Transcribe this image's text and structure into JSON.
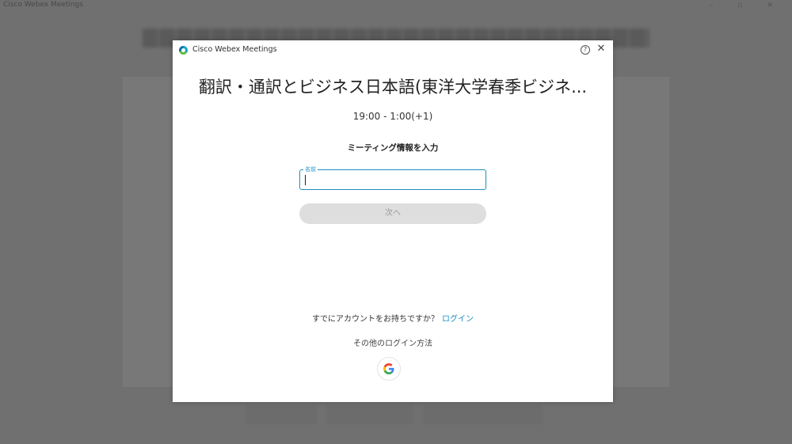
{
  "background_window": {
    "title": "Cisco Webex Meetings"
  },
  "dialog": {
    "app_title": "Cisco Webex Meetings",
    "meeting_title": "翻訳・通訳とビジネス日本語(東洋大学春季ビジネ...",
    "meeting_time": "19:00 - 1:00(+1)",
    "info_heading": "ミーティング情報を入力",
    "name_field": {
      "label": "名前",
      "value": ""
    },
    "next_button_label": "次へ",
    "account_prompt": "すでにアカウントをお持ちですか？",
    "login_link": "ログイン",
    "other_login_label": "その他のログイン方法",
    "icons": {
      "app_logo": "webex-logo",
      "help": "help-icon",
      "close": "close-icon",
      "google": "google-icon"
    },
    "colors": {
      "accent": "#1a8fc0",
      "disabled_button": "#dedede"
    }
  }
}
